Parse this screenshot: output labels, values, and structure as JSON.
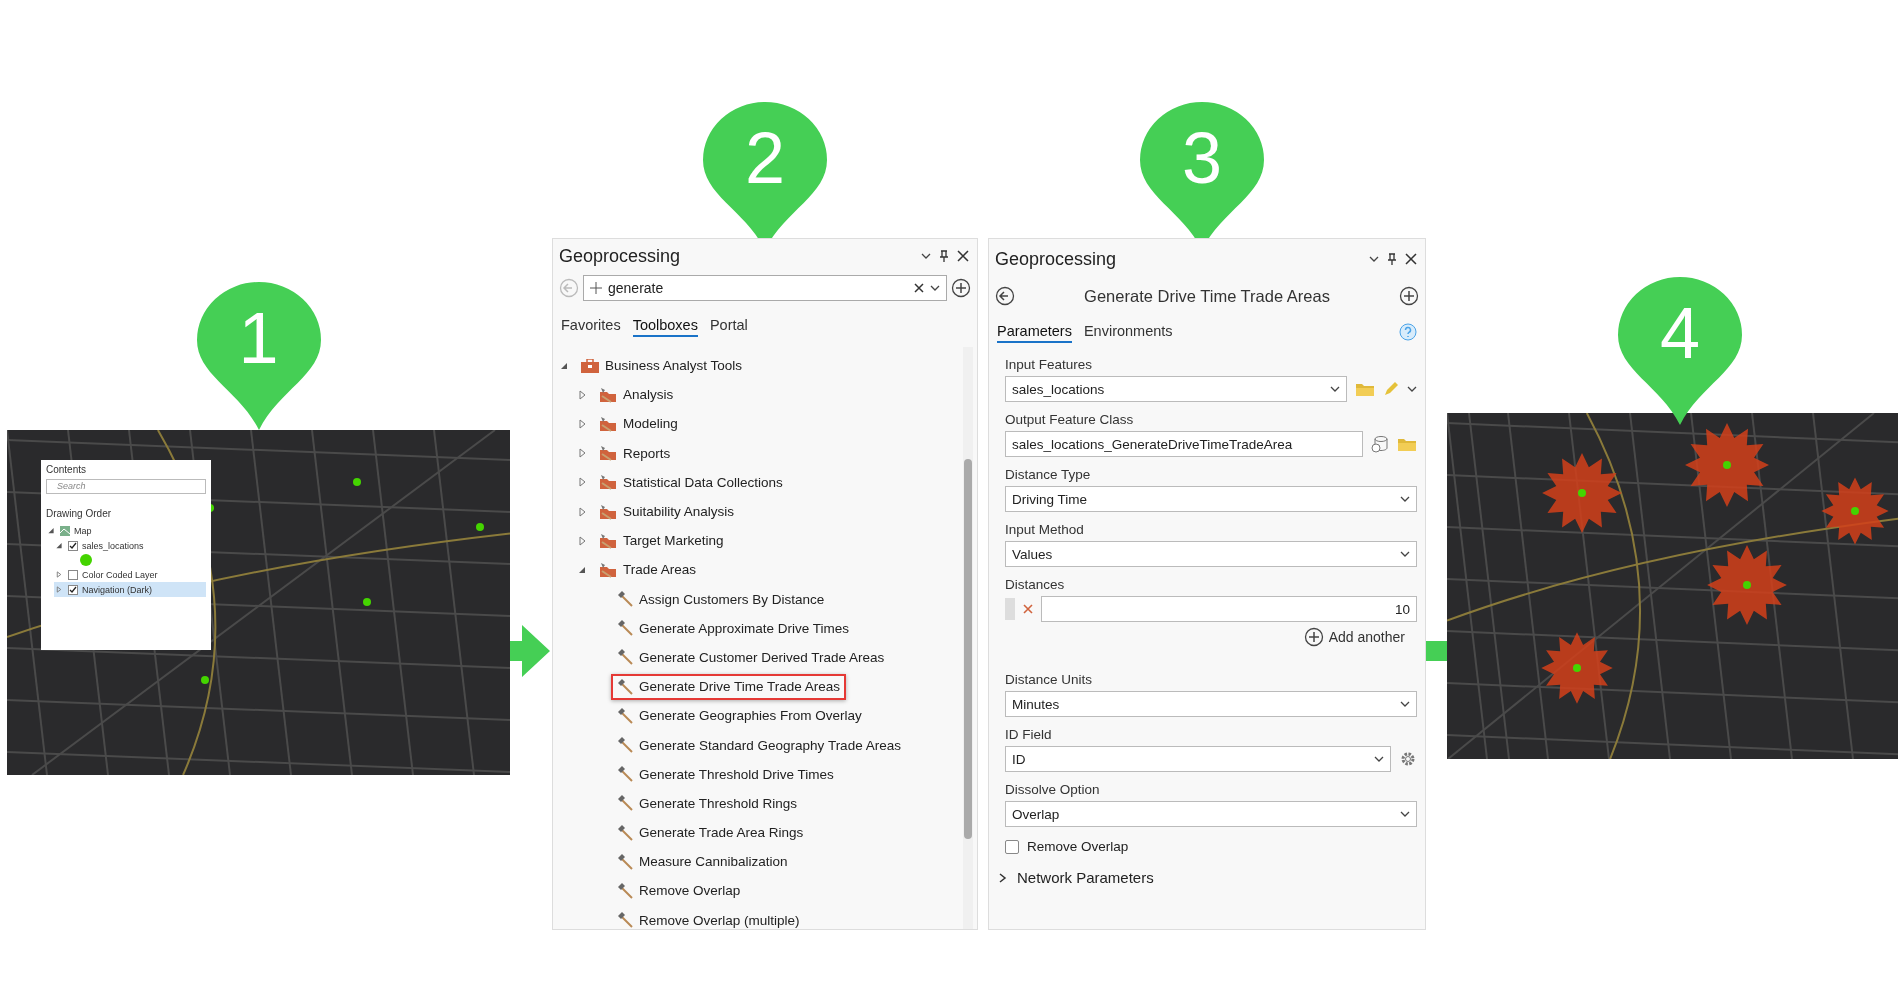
{
  "markers": [
    {
      "label": "1"
    },
    {
      "label": "2"
    },
    {
      "label": "3"
    },
    {
      "label": "4"
    }
  ],
  "contents_pane": {
    "title": "Contents",
    "search": {
      "placeholder": "Search"
    },
    "heading": "Drawing Order",
    "layers": [
      {
        "name": "Map",
        "expanded": true,
        "children": [
          {
            "name": "sales_locations",
            "checked": true,
            "expanded": true,
            "selected": false
          },
          {
            "name": "Color Coded Layer",
            "checked": false,
            "expanded": false,
            "selected": false
          },
          {
            "name": "Navigation (Dark)",
            "checked": true,
            "expanded": false,
            "selected": true
          }
        ]
      }
    ]
  },
  "search_pane": {
    "title": "Geoprocessing",
    "search": {
      "value": "generate"
    },
    "tabs": [
      {
        "label": "Favorites",
        "selected": false
      },
      {
        "label": "Toolboxes",
        "selected": true
      },
      {
        "label": "Portal",
        "selected": false
      }
    ],
    "tree": [
      {
        "label": "Business Analyst Tools",
        "kind": "toolbox",
        "expanded": true,
        "children": [
          {
            "label": "Analysis",
            "kind": "toolset",
            "expanded": false
          },
          {
            "label": "Modeling",
            "kind": "toolset",
            "expanded": false
          },
          {
            "label": "Reports",
            "kind": "toolset",
            "expanded": false
          },
          {
            "label": "Statistical Data Collections",
            "kind": "toolset",
            "expanded": false
          },
          {
            "label": "Suitability Analysis",
            "kind": "toolset",
            "expanded": false
          },
          {
            "label": "Target Marketing",
            "kind": "toolset",
            "expanded": false
          },
          {
            "label": "Trade Areas",
            "kind": "toolset",
            "expanded": true,
            "children": [
              {
                "label": "Assign Customers By Distance",
                "kind": "tool",
                "highlighted": false
              },
              {
                "label": "Generate Approximate Drive Times",
                "kind": "tool",
                "highlighted": false
              },
              {
                "label": "Generate Customer Derived Trade Areas",
                "kind": "tool",
                "highlighted": false
              },
              {
                "label": "Generate Drive Time Trade Areas",
                "kind": "tool",
                "highlighted": true
              },
              {
                "label": "Generate Geographies From Overlay",
                "kind": "tool",
                "highlighted": false
              },
              {
                "label": "Generate Standard Geography Trade Areas",
                "kind": "tool",
                "highlighted": false
              },
              {
                "label": "Generate Threshold Drive Times",
                "kind": "tool",
                "highlighted": false
              },
              {
                "label": "Generate Threshold Rings",
                "kind": "tool",
                "highlighted": false
              },
              {
                "label": "Generate Trade Area Rings",
                "kind": "tool",
                "highlighted": false
              },
              {
                "label": "Measure Cannibalization",
                "kind": "tool",
                "highlighted": false
              },
              {
                "label": "Remove Overlap",
                "kind": "tool",
                "highlighted": false
              },
              {
                "label": "Remove Overlap (multiple)",
                "kind": "tool",
                "highlighted": false
              }
            ]
          }
        ]
      }
    ]
  },
  "tool_pane": {
    "title": "Geoprocessing",
    "tool_title": "Generate Drive Time Trade Areas",
    "tabs": [
      {
        "label": "Parameters",
        "selected": true
      },
      {
        "label": "Environments",
        "selected": false
      }
    ],
    "parameters": [
      {
        "kind": "layer-dropdown",
        "label": "Input Features",
        "value": "sales_locations"
      },
      {
        "kind": "output-text",
        "label": "Output Feature Class",
        "value": "sales_locations_GenerateDriveTimeTradeArea"
      },
      {
        "kind": "dropdown",
        "label": "Distance Type",
        "value": "Driving Time"
      },
      {
        "kind": "dropdown",
        "label": "Input Method",
        "value": "Values"
      },
      {
        "kind": "values",
        "label": "Distances",
        "values": [
          "10"
        ],
        "add_label": "Add another"
      },
      {
        "kind": "dropdown",
        "label": "Distance Units",
        "value": "Minutes"
      },
      {
        "kind": "field-dropdown",
        "label": "ID Field",
        "value": "ID"
      },
      {
        "kind": "dropdown",
        "label": "Dissolve Option",
        "value": "Overlap"
      },
      {
        "kind": "checkbox",
        "label": "Remove Overlap",
        "checked": false
      }
    ],
    "sections": [
      {
        "label": "Network Parameters",
        "expanded": false
      }
    ]
  }
}
